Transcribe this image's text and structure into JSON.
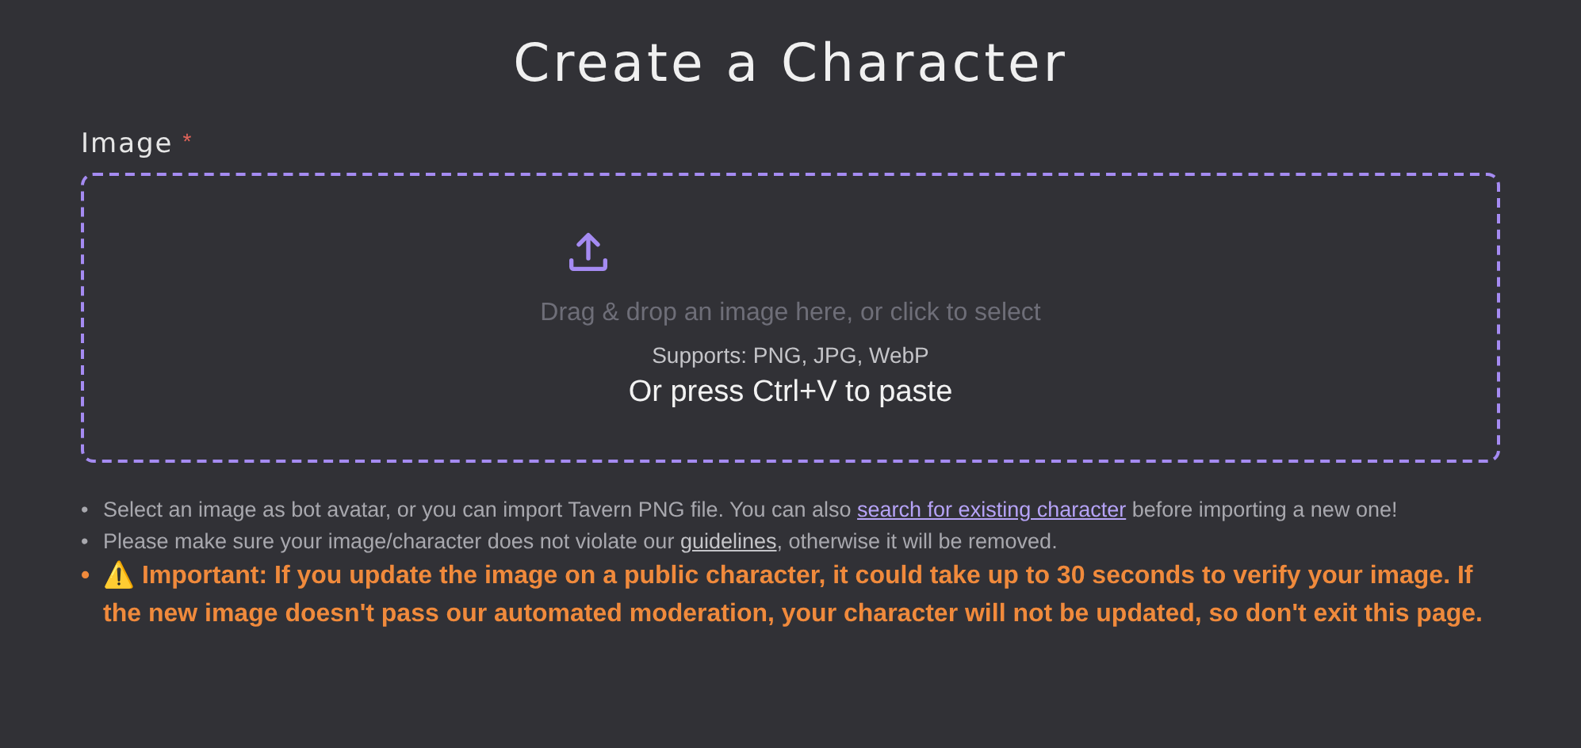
{
  "title": "Create a Character",
  "image_field": {
    "label": "Image",
    "required": true,
    "required_mark": "*",
    "dropzone": {
      "prompt": "Drag & drop an image here, or click to select",
      "formats": "Supports: PNG, JPG, WebP",
      "paste_hint": "Or press Ctrl+V to paste"
    }
  },
  "notes": [
    {
      "kind": "plain",
      "marker": "•",
      "text_before": "Select an image as bot avatar, or you can import Tavern PNG file. You can also ",
      "link": "search for existing character",
      "color": "#b6a3f7",
      "text_after": " before importing a new one!"
    },
    {
      "kind": "plain",
      "marker": "•",
      "text_before": "Please make sure your image/character does not violate our ",
      "link": "guidelines",
      "color": "#c4c4c8",
      "text_after": ", otherwise it will be removed."
    },
    {
      "kind": "warning",
      "marker": "•",
      "icon": "⚠️",
      "text": "**Important:** If you update the image on a public character, it could take up to 30 seconds to verify your image. If the new image doesn't pass our automated moderation, your character will not be updated, so don't exit this page."
    }
  ]
}
